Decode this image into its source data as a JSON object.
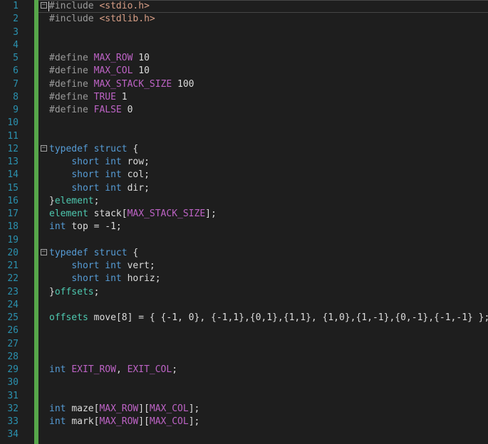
{
  "editor": {
    "theme": {
      "background": "#1e1e1e",
      "line_number": "#2b91af",
      "keyword": "#569cd6",
      "preprocessor": "#9b9b9b",
      "string": "#d69d85",
      "macro": "#bd63c5",
      "change_bar": "#57a64a"
    },
    "lines": [
      {
        "num": "1",
        "code": "#include <stdio.h>"
      },
      {
        "num": "2",
        "code": "#include <stdlib.h>"
      },
      {
        "num": "3",
        "code": ""
      },
      {
        "num": "4",
        "code": ""
      },
      {
        "num": "5",
        "code": "#define MAX_ROW 10"
      },
      {
        "num": "6",
        "code": "#define MAX_COL 10"
      },
      {
        "num": "7",
        "code": "#define MAX_STACK_SIZE 100"
      },
      {
        "num": "8",
        "code": "#define TRUE 1"
      },
      {
        "num": "9",
        "code": "#define FALSE 0"
      },
      {
        "num": "10",
        "code": ""
      },
      {
        "num": "11",
        "code": ""
      },
      {
        "num": "12",
        "code": "typedef struct {"
      },
      {
        "num": "13",
        "code": "    short int row;"
      },
      {
        "num": "14",
        "code": "    short int col;"
      },
      {
        "num": "15",
        "code": "    short int dir;"
      },
      {
        "num": "16",
        "code": "}element;"
      },
      {
        "num": "17",
        "code": "element stack[MAX_STACK_SIZE];"
      },
      {
        "num": "18",
        "code": "int top = -1;"
      },
      {
        "num": "19",
        "code": ""
      },
      {
        "num": "20",
        "code": "typedef struct {"
      },
      {
        "num": "21",
        "code": "    short int vert;"
      },
      {
        "num": "22",
        "code": "    short int horiz;"
      },
      {
        "num": "23",
        "code": "}offsets;"
      },
      {
        "num": "24",
        "code": ""
      },
      {
        "num": "25",
        "code": "offsets move[8] = { {-1, 0}, {-1,1},{0,1},{1,1}, {1,0},{1,-1},{0,-1},{-1,-1} };"
      },
      {
        "num": "26",
        "code": ""
      },
      {
        "num": "27",
        "code": ""
      },
      {
        "num": "28",
        "code": ""
      },
      {
        "num": "29",
        "code": "int EXIT_ROW, EXIT_COL;"
      },
      {
        "num": "30",
        "code": ""
      },
      {
        "num": "31",
        "code": ""
      },
      {
        "num": "32",
        "code": "int maze[MAX_ROW][MAX_COL];"
      },
      {
        "num": "33",
        "code": "int mark[MAX_ROW][MAX_COL];"
      },
      {
        "num": "34",
        "code": ""
      }
    ],
    "fold_markers": [
      "1",
      "12",
      "20"
    ],
    "fold_icon": "minus-box-icon"
  }
}
